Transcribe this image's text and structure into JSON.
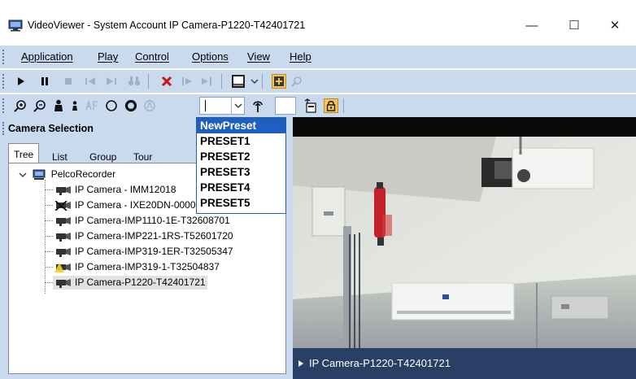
{
  "window": {
    "title": "VideoViewer - System Account IP Camera-P1220-T42401721"
  },
  "window_controls": {
    "minimize": "—",
    "maximize": "☐",
    "close": "✕"
  },
  "menu": [
    "Application",
    "Play",
    "Control",
    "Options",
    "View",
    "Help"
  ],
  "panel": {
    "header": "Camera Selection",
    "tabs": [
      "Tree",
      "List",
      "Group",
      "Tour"
    ],
    "active_tab": "Tree"
  },
  "tree": {
    "root": "PelcoRecorder",
    "items": [
      "IP Camera - IMM12018",
      "IP Camera - IXE20DN-0000051",
      "IP Camera-IMP1110-1E-T32608701",
      "IP Camera-IMP221-1RS-T52601720",
      "IP Camera-IMP319-1ER-T32505347",
      "IP Camera-IMP319-1-T32504837",
      "IP Camera-P1220-T42401721"
    ],
    "selected": "IP Camera-P1220-T42401721"
  },
  "preset_dropdown": {
    "items": [
      "NewPreset",
      "PRESET1",
      "PRESET2",
      "PRESET3",
      "PRESET4",
      "PRESET5"
    ],
    "selected": "NewPreset"
  },
  "video": {
    "caption": "IP Camera-P1220-T42401721"
  },
  "colors": {
    "chrome": "#c9d9ee",
    "selection": "#1f5fbf",
    "video_caption": "#2a3f66"
  }
}
